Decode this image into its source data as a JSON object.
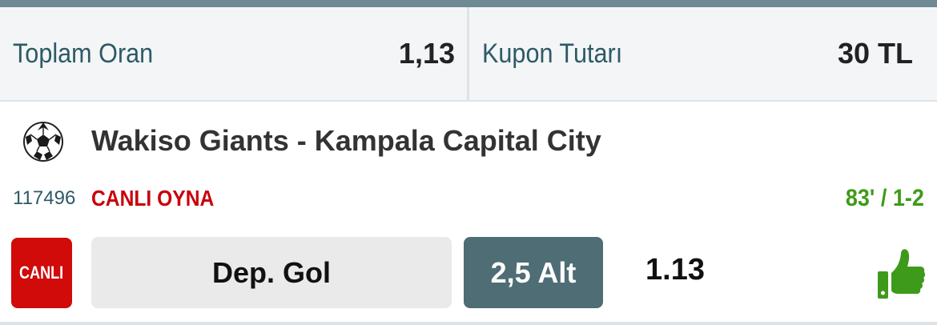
{
  "summary": {
    "total_odds_label": "Toplam Oran",
    "total_odds_value": "1,13",
    "coupon_amount_label": "Kupon Tutarı",
    "coupon_amount_value": "30 TL"
  },
  "match": {
    "sport_icon": "soccer-ball-icon",
    "title": "Wakiso Giants - Kampala Capital City",
    "event_id": "117496",
    "live_play_label": "CANLI OYNA",
    "minute_score": "83' / 1-2",
    "live_badge": "CANLI",
    "market": "Dep. Gol",
    "selection": "2,5 Alt",
    "odds": "1.13",
    "status_icon": "thumbs-up-icon"
  },
  "colors": {
    "topbar": "#6e8a94",
    "label_text": "#2d5a66",
    "live_red": "#c8000a",
    "score_green": "#3e9a1a",
    "selection_bg": "#4e6d74",
    "thumb_green": "#3e9a1a"
  }
}
